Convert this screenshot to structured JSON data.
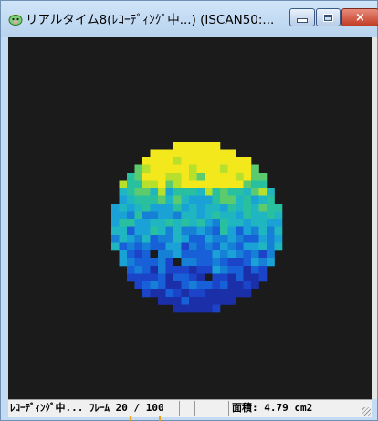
{
  "window": {
    "title": "リアルタイム8(ﾚｺｰﾃﾞｨﾝｸﾞ中...) (ISCAN50:...",
    "icon": "pig-icon",
    "controls": {
      "minimize": "minimize-icon",
      "maximize": "maximize-icon",
      "close": "×"
    }
  },
  "image": {
    "colormap": [
      "#1a2fa8",
      "#1b44c9",
      "#1760d8",
      "#1580d6",
      "#1aa1d6",
      "#1fb6c2",
      "#29c0a0",
      "#5ccb6e",
      "#b7e02d",
      "#f2e81c"
    ],
    "background": "#1c1b1c"
  },
  "status": {
    "recording": "ﾚｺｰﾃﾞｨﾝｸﾞ中... ﾌﾚｰﾑ 20 / 100",
    "pane2": "",
    "pane3": "",
    "area": "面積: 4.79 cm2"
  }
}
